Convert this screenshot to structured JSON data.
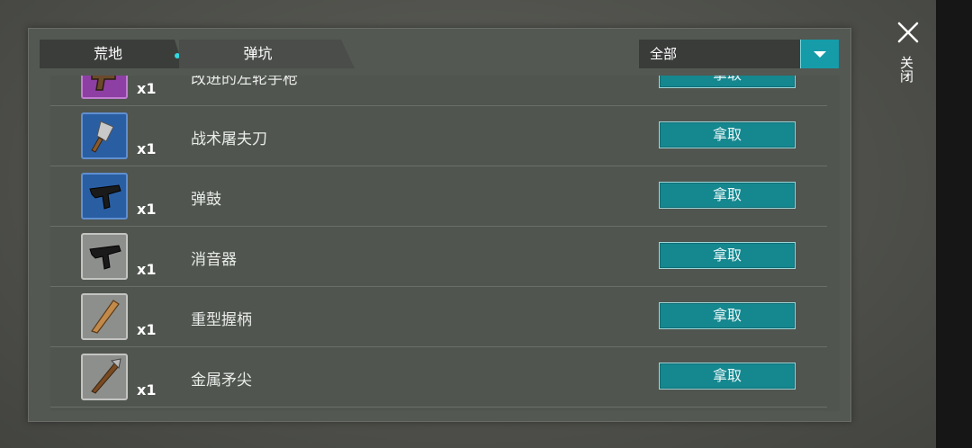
{
  "tabs": [
    {
      "label": "荒地",
      "active": true
    },
    {
      "label": "弹坑",
      "active": false
    }
  ],
  "filter": {
    "selected": "全部"
  },
  "close_label": "关闭",
  "colors": {
    "accent": "#169ca9",
    "button": "#15878f",
    "dot": "#34d6e0"
  },
  "items": [
    {
      "name": "改进的左轮手枪",
      "qty": "x1",
      "action": "拿取",
      "rarity": "purple",
      "icon": "revolver-icon"
    },
    {
      "name": "战术屠夫刀",
      "qty": "x1",
      "action": "拿取",
      "rarity": "blue",
      "icon": "cleaver-icon"
    },
    {
      "name": "弹鼓",
      "qty": "x1",
      "action": "拿取",
      "rarity": "blue",
      "icon": "smg-icon"
    },
    {
      "name": "消音器",
      "qty": "x1",
      "action": "拿取",
      "rarity": "gray",
      "icon": "smg-icon"
    },
    {
      "name": "重型握柄",
      "qty": "x1",
      "action": "拿取",
      "rarity": "gray",
      "icon": "bat-icon"
    },
    {
      "name": "金属矛尖",
      "qty": "x1",
      "action": "拿取",
      "rarity": "gray",
      "icon": "spear-icon"
    }
  ]
}
